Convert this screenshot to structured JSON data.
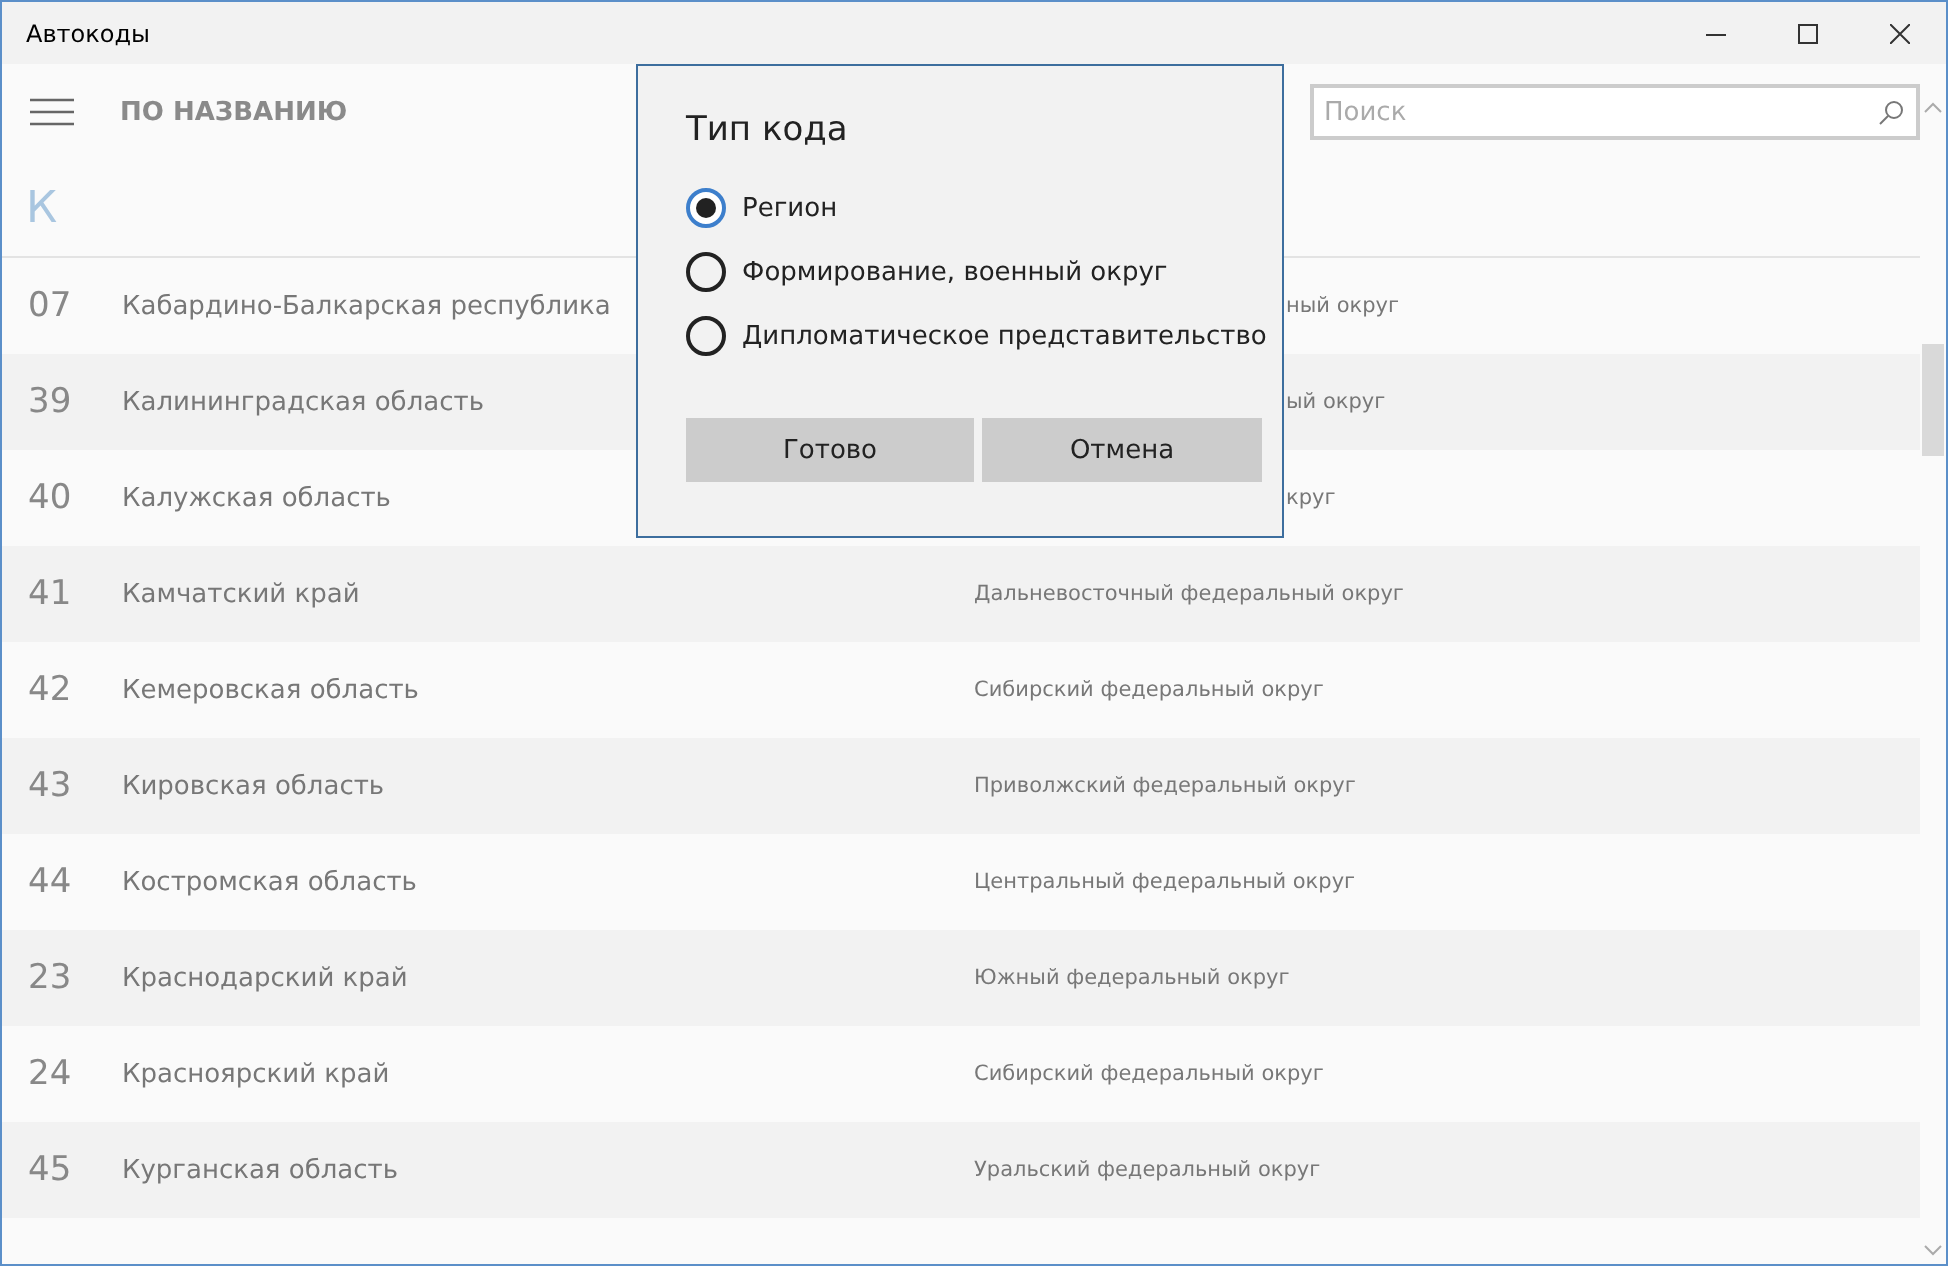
{
  "window": {
    "title": "Автокоды"
  },
  "header": {
    "sort_label": "ПО НАЗВАНИЮ",
    "search": {
      "placeholder": "Поиск"
    }
  },
  "group_letter": "К",
  "rows": [
    {
      "code": "07",
      "name": "Кабардино-Балкарская республика",
      "district": "ный округ",
      "covered": true
    },
    {
      "code": "39",
      "name": "Калининградская область",
      "district": "ый округ",
      "covered": true
    },
    {
      "code": "40",
      "name": "Калужская область",
      "district": "круг",
      "covered": true
    },
    {
      "code": "41",
      "name": "Камчатский край",
      "district": "Дальневосточный федеральный округ"
    },
    {
      "code": "42",
      "name": "Кемеровская область",
      "district": "Сибирский федеральный округ"
    },
    {
      "code": "43",
      "name": "Кировская область",
      "district": "Приволжский федеральный округ"
    },
    {
      "code": "44",
      "name": "Костромская область",
      "district": "Центральный федеральный округ"
    },
    {
      "code": "23",
      "name": "Краснодарский край",
      "district": "Южный федеральный округ"
    },
    {
      "code": "24",
      "name": "Красноярский край",
      "district": "Сибирский федеральный округ"
    },
    {
      "code": "45",
      "name": "Курганская область",
      "district": "Уральский федеральный округ"
    }
  ],
  "dialog": {
    "title": "Тип кода",
    "options": [
      {
        "label": "Регион",
        "selected": true
      },
      {
        "label": "Формирование, военный округ",
        "selected": false
      },
      {
        "label": "Дипломатическое представительство",
        "selected": false
      }
    ],
    "buttons": [
      "Готово",
      "Отмена"
    ]
  }
}
